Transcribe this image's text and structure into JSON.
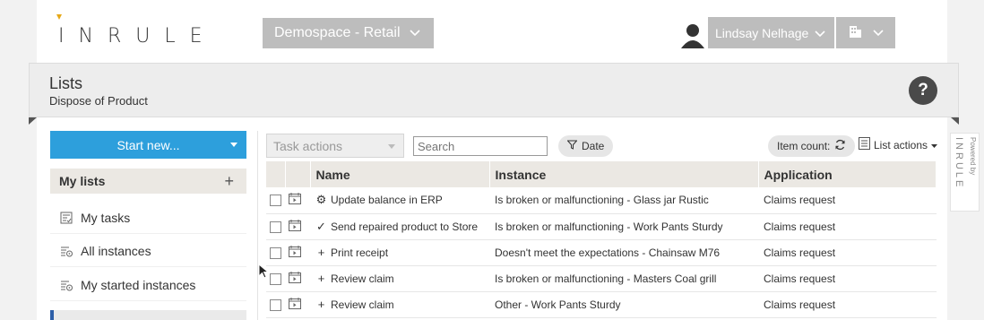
{
  "app": {
    "logo_text": "INRULE",
    "workspace": "Demospace - Retail",
    "user_name": "Lindsay Nelhage"
  },
  "page": {
    "title": "Lists",
    "subtitle": "Dispose of Product",
    "help_label": "?"
  },
  "sidebar": {
    "start_label": "Start new...",
    "my_lists_label": "My lists",
    "items": [
      {
        "label": "My tasks",
        "icon": "task-list-icon"
      },
      {
        "label": "All instances",
        "icon": "instance-list-icon"
      },
      {
        "label": "My started instances",
        "icon": "instance-list-icon"
      }
    ]
  },
  "toolbar": {
    "task_actions_label": "Task actions",
    "search_placeholder": "Search",
    "date_filter_label": "Date",
    "item_count_label": "Item count:",
    "list_actions_label": "List actions"
  },
  "table": {
    "headers": {
      "name": "Name",
      "instance": "Instance",
      "application": "Application"
    },
    "rows": [
      {
        "icon": "⚙",
        "name": "Update balance in ERP",
        "instance": "Is broken or malfunctioning - Glass jar Rustic",
        "application": "Claims request"
      },
      {
        "icon": "✓",
        "name": "Send repaired product to Store",
        "instance": "Is broken or malfunctioning - Work Pants Sturdy",
        "application": "Claims request"
      },
      {
        "icon": "+",
        "name": "Print receipt",
        "instance": "Doesn't meet the expectations - Chainsaw M76",
        "application": "Claims request"
      },
      {
        "icon": "+",
        "name": "Review claim",
        "instance": "Is broken or malfunctioning - Masters Coal grill",
        "application": "Claims request"
      },
      {
        "icon": "+",
        "name": "Review claim",
        "instance": "Other - Work Pants Sturdy",
        "application": "Claims request"
      }
    ]
  },
  "powered_by": {
    "label": "Powered by",
    "brand": "INRULE"
  },
  "colors": {
    "accent": "#2d9fdc",
    "header_bg": "#ebe8e3",
    "gray_button": "#bdbdbd"
  }
}
